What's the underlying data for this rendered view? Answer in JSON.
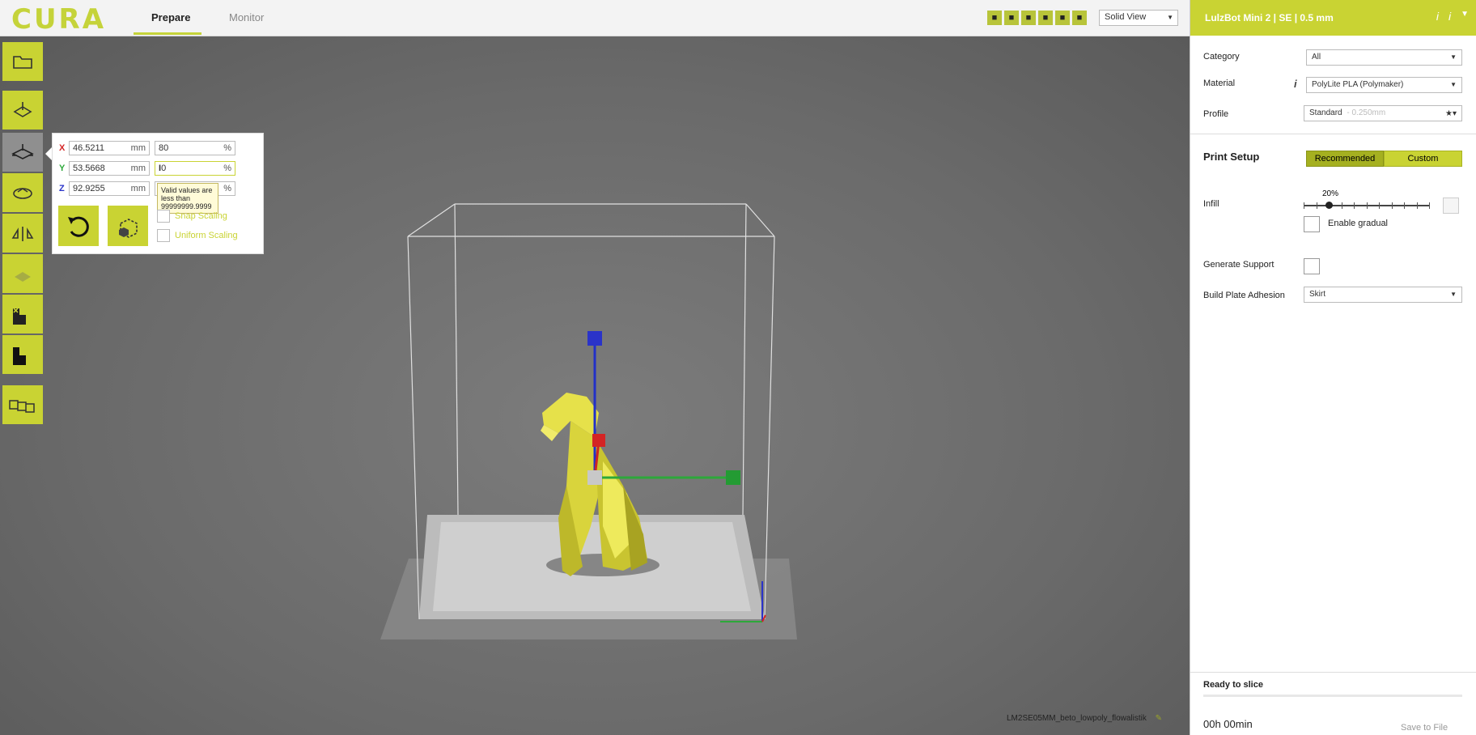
{
  "app": {
    "logo": "CURA"
  },
  "tabs": [
    {
      "label": "Prepare"
    },
    {
      "label": "Monitor"
    }
  ],
  "view": {
    "mode": "Solid View"
  },
  "toolbar": {
    "tools": [
      "open-file",
      "translate",
      "scale",
      "rotate",
      "mirror",
      "per-model-settings",
      "support-blocker",
      "layer-view",
      "multiply"
    ]
  },
  "scale": {
    "x": {
      "axis": "X",
      "mm": "46.5211",
      "percent": "80",
      "unit_mm": "mm",
      "unit_pct": "%"
    },
    "y": {
      "axis": "Y",
      "mm": "53.5668",
      "percent": "0",
      "unit_mm": "mm",
      "unit_pct": "%"
    },
    "z": {
      "axis": "Z",
      "mm": "92.9255",
      "percent": "",
      "unit_mm": "mm",
      "unit_pct": "%"
    },
    "tooltip": "Valid values are less than 99999999.9999",
    "snap_label": "Snap Scaling",
    "uniform_label": "Uniform Scaling"
  },
  "right": {
    "printer": "LulzBot Mini 2 | SE | 0.5 mm",
    "category_label": "Category",
    "category_value": "All",
    "material_label": "Material",
    "material_value": "PolyLite PLA (Polymaker)",
    "profile_label": "Profile",
    "profile_value": "Standard",
    "profile_detail": "- 0.250mm",
    "print_setup": "Print Setup",
    "recommended": "Recommended",
    "custom": "Custom",
    "infill_label": "Infill",
    "infill_value": "20%",
    "infill_fraction": 0.2,
    "gradual_label": "Enable gradual",
    "support_label": "Generate Support",
    "adhesion_label": "Build Plate Adhesion",
    "adhesion_value": "Skirt",
    "ready": "Ready to slice",
    "time": "00h 00min",
    "save": "Save to File"
  },
  "object": {
    "filename": "LM2SE05MM_beto_lowpoly_flowalistik"
  }
}
